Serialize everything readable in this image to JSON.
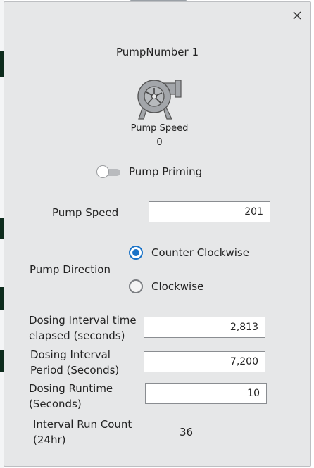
{
  "dialog": {
    "title": "PumpNumber 1",
    "pump_icon": "pump-icon",
    "speed_caption": "Pump Speed",
    "speed_value": "0",
    "priming": {
      "label": "Pump Priming",
      "on": false
    },
    "pump_speed": {
      "label": "Pump Speed",
      "value": "201"
    },
    "direction": {
      "label": "Pump Direction",
      "options": [
        {
          "label": "Counter Clockwise",
          "selected": true
        },
        {
          "label": "Clockwise",
          "selected": false
        }
      ]
    },
    "interval_elapsed": {
      "label_line1": "Dosing Interval time",
      "label_line2": "elapsed (seconds)",
      "value": "2,813"
    },
    "interval_period": {
      "label_line1": "Dosing Interval",
      "label_line2": "Period (Seconds)",
      "value": "7,200"
    },
    "runtime": {
      "label_line1": "Dosing Runtime",
      "label_line2": "(Seconds)",
      "value": "10"
    },
    "run_count": {
      "label_line1": "Interval Run Count",
      "label_line2": "(24hr)",
      "value": "36"
    }
  },
  "colors": {
    "accent": "#1a73c8",
    "dialog_bg": "#e6e7e8",
    "field_border": "#8a8d91"
  }
}
